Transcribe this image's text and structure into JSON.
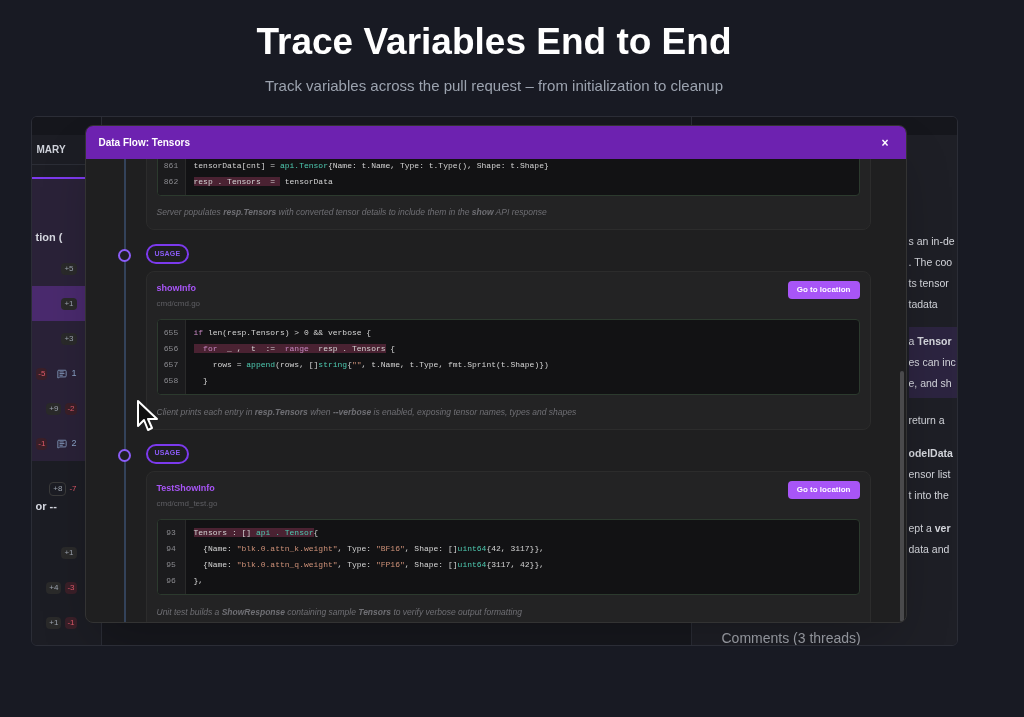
{
  "header": {
    "title": "Trace Variables End to End",
    "subtitle": "Track variables across the pull request – from initialization to cleanup"
  },
  "sidebar": {
    "heading": "MARY",
    "sections": [
      {
        "title": "tion (",
        "active": true,
        "files": [
          {
            "additions": "+5",
            "selected": false
          },
          {
            "additions": "+1",
            "selected": true
          },
          {
            "additions": "+3",
            "selected": false
          },
          {
            "deletions": "-5",
            "comments": "1",
            "selected": false
          },
          {
            "additions": "+9",
            "deletions": "-2",
            "selected": false
          },
          {
            "deletions": "-1",
            "comments": "2",
            "selected": false
          }
        ]
      },
      {
        "additions": "+8",
        "deletions": "-7",
        "title": "or --",
        "active": false,
        "files": [
          {
            "additions": "+1",
            "selected": false
          },
          {
            "additions": "+4",
            "deletions": "-3",
            "selected": false
          },
          {
            "additions": "+1",
            "deletions": "-1",
            "selected": false
          }
        ]
      }
    ]
  },
  "right_panel": {
    "paragraphs": [
      {
        "highlighted": false,
        "lines": [
          "s an in-de",
          ". The coo",
          "ts tensor",
          "tadata"
        ]
      },
      {
        "highlighted": true,
        "lines": [
          "a **Tensor**",
          "es can inc",
          "e, and sh"
        ]
      },
      {
        "highlighted": false,
        "lines": [
          "return a"
        ]
      },
      {
        "highlighted": false,
        "lines": [
          "**odelData**",
          "ensor list",
          "t into the"
        ]
      },
      {
        "highlighted": false,
        "lines": [
          "ept a **ver**",
          "data and"
        ]
      }
    ],
    "comments_heading": "Comments (3 threads)"
  },
  "modal": {
    "title": "Data Flow: Tensors",
    "close": "×",
    "cards": [
      {
        "kind": "clipped",
        "code": [
          {
            "number": "861",
            "segments": [
              {
                "text": "tensorData[cnt] = ",
                "kind": "plain",
                "highlight": false
              },
              {
                "text": "api.Tensor",
                "kind": "fn",
                "highlight": false
              },
              {
                "text": "{Name: t.Name, Type: t.Type(), Shape: t.Shape}",
                "kind": "plain",
                "highlight": false
              }
            ]
          },
          {
            "number": "862",
            "segments": [
              {
                "text": "resp . Tensors  = ",
                "kind": "plain",
                "highlight": true
              },
              {
                "text": " tensorData",
                "kind": "plain",
                "highlight": false
              }
            ]
          }
        ],
        "description": "Server populates **resp.Tensors** with converted tensor details to include them in the **show** API response"
      },
      {
        "kind": "full",
        "badge": "USAGE",
        "title": "showInfo",
        "path": "cmd/cmd.go",
        "button": "Go to location",
        "code": [
          {
            "number": "655",
            "segments": [
              {
                "text": "if",
                "kind": "kw",
                "highlight": false
              },
              {
                "text": " len(resp.Tensors) > 0 && verbose {",
                "kind": "plain",
                "highlight": false
              }
            ]
          },
          {
            "number": "656",
            "segments": [
              {
                "text": "  for",
                "kind": "kw",
                "highlight": true
              },
              {
                "text": "  _ ,  t  := ",
                "kind": "plain",
                "highlight": true
              },
              {
                "text": " range",
                "kind": "kw",
                "highlight": true
              },
              {
                "text": "  resp . Tensors",
                "kind": "plain",
                "highlight": true
              },
              {
                "text": " {",
                "kind": "plain",
                "highlight": false
              }
            ]
          },
          {
            "number": "657",
            "segments": [
              {
                "text": "    rows = ",
                "kind": "plain",
                "highlight": false
              },
              {
                "text": "append",
                "kind": "fn",
                "highlight": false
              },
              {
                "text": "(rows, []",
                "kind": "plain",
                "highlight": false
              },
              {
                "text": "string",
                "kind": "type",
                "highlight": false
              },
              {
                "text": "{",
                "kind": "plain",
                "highlight": false
              },
              {
                "text": "\"\"",
                "kind": "str",
                "highlight": false
              },
              {
                "text": ", t.Name, t.Type, fmt.Sprint(t.Shape)})",
                "kind": "plain",
                "highlight": false
              }
            ]
          },
          {
            "number": "658",
            "segments": [
              {
                "text": "  }",
                "kind": "plain",
                "highlight": false
              }
            ]
          }
        ],
        "description": "Client prints each entry in **resp.Tensors** when **--verbose** is enabled, exposing tensor names, types and shapes"
      },
      {
        "kind": "full",
        "badge": "USAGE",
        "title": "TestShowInfo",
        "path": "cmd/cmd_test.go",
        "button": "Go to location",
        "code": [
          {
            "number": "93",
            "segments": [
              {
                "text": "Tensors : [] ",
                "kind": "plain",
                "highlight": true
              },
              {
                "text": "api . Tensor",
                "kind": "type",
                "highlight": true
              },
              {
                "text": "{",
                "kind": "plain",
                "highlight": false
              }
            ]
          },
          {
            "number": "94",
            "segments": [
              {
                "text": "  {Name: ",
                "kind": "plain",
                "highlight": false
              },
              {
                "text": "\"blk.0.attn_k.weight\"",
                "kind": "str",
                "highlight": false
              },
              {
                "text": ", Type: ",
                "kind": "plain",
                "highlight": false
              },
              {
                "text": "\"BF16\"",
                "kind": "str",
                "highlight": false
              },
              {
                "text": ", Shape: []",
                "kind": "plain",
                "highlight": false
              },
              {
                "text": "uint64",
                "kind": "type",
                "highlight": false
              },
              {
                "text": "{42, 3117}},",
                "kind": "plain",
                "highlight": false
              }
            ]
          },
          {
            "number": "95",
            "segments": [
              {
                "text": "  {Name: ",
                "kind": "plain",
                "highlight": false
              },
              {
                "text": "\"blk.0.attn_q.weight\"",
                "kind": "str",
                "highlight": false
              },
              {
                "text": ", Type: ",
                "kind": "plain",
                "highlight": false
              },
              {
                "text": "\"FP16\"",
                "kind": "str",
                "highlight": false
              },
              {
                "text": ", Shape: []",
                "kind": "plain",
                "highlight": false
              },
              {
                "text": "uint64",
                "kind": "type",
                "highlight": false
              },
              {
                "text": "{3117, 42}},",
                "kind": "plain",
                "highlight": false
              }
            ]
          },
          {
            "number": "96",
            "segments": [
              {
                "text": "},",
                "kind": "plain",
                "highlight": false
              }
            ]
          }
        ],
        "description": "Unit test builds a **ShowResponse** containing sample **Tensors** to verify verbose output formatting"
      }
    ]
  }
}
